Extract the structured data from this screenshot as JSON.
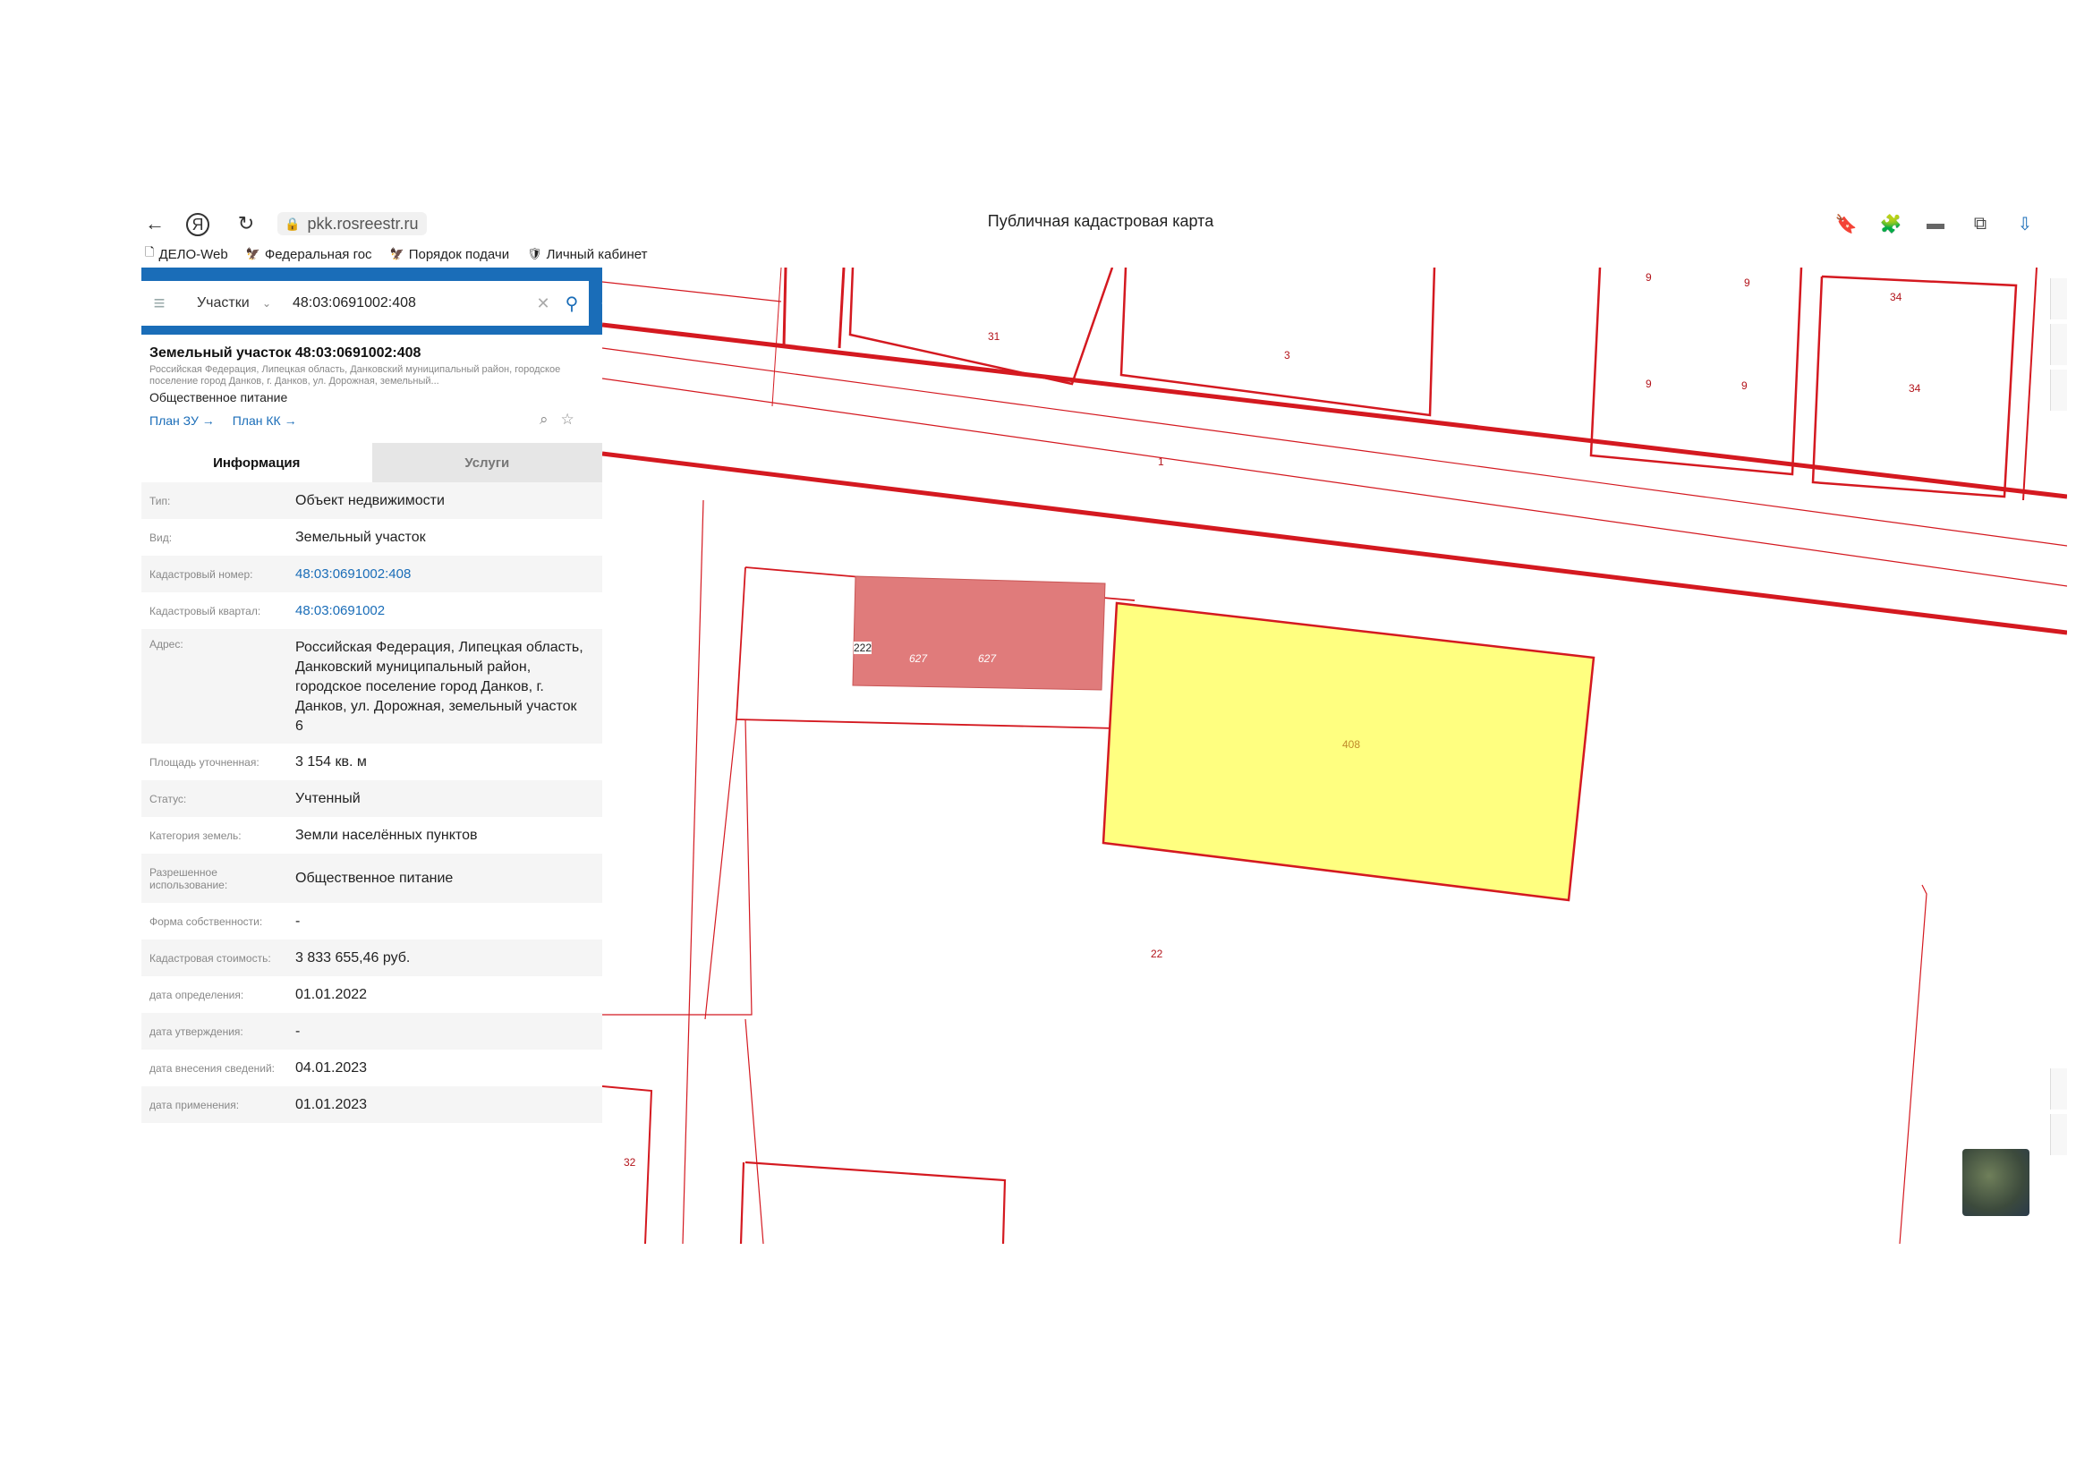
{
  "browser": {
    "url": "pkk.rosreestr.ru",
    "page_title": "Публичная кадастровая карта",
    "bookmarks": [
      {
        "label": "ДЕЛО-Web"
      },
      {
        "label": "Федеральная гос"
      },
      {
        "label": "Порядок подачи"
      },
      {
        "label": "Личный кабинет"
      }
    ]
  },
  "search": {
    "type": "Участки",
    "query": "48:03:0691002:408"
  },
  "object": {
    "title": "Земельный участок 48:03:0691002:408",
    "address_short": "Российская Федерация, Липецкая область, Данковский муниципальный район, городское поселение город Данков, г. Данков, ул. Дорожная, земельный...",
    "use": "Общественное питание",
    "plan_zu": "План ЗУ →",
    "plan_kk": "План КК →"
  },
  "tabs": [
    {
      "label": "Информация"
    },
    {
      "label": "Услуги"
    }
  ],
  "info": [
    {
      "label": "Тип:",
      "value": "Объект недвижимости"
    },
    {
      "label": "Вид:",
      "value": "Земельный участок"
    },
    {
      "label": "Кадастровый номер:",
      "value": "48:03:0691002:408"
    },
    {
      "label": "Кадастровый квартал:",
      "value": "48:03:0691002"
    },
    {
      "label": "Адрес:",
      "value": "Российская Федерация, Липецкая область, Данковский муниципальный район, городское поселение город Данков, г. Данков, ул. Дорожная, земельный участок 6"
    },
    {
      "label": "Площадь уточненная:",
      "value": "3 154 кв. м"
    },
    {
      "label": "Статус:",
      "value": "Учтенный"
    },
    {
      "label": "Категория земель:",
      "value": "Земли населённых пунктов"
    },
    {
      "label": "Разрешенное использование:",
      "value": "Общественное питание"
    },
    {
      "label": "Форма собственности:",
      "value": "-"
    },
    {
      "label": "Кадастровая стоимость:",
      "value": "3 833 655,46 руб."
    },
    {
      "label": "дата определения:",
      "value": "01.01.2022"
    },
    {
      "label": "дата утверждения:",
      "value": "-"
    },
    {
      "label": "дата внесения сведений:",
      "value": "04.01.2023"
    },
    {
      "label": "дата применения:",
      "value": "01.01.2023"
    }
  ],
  "map": {
    "parcel_labels": [
      "31",
      "3",
      "9",
      "9",
      "9",
      "9",
      "34",
      "34",
      "1",
      "222",
      "627",
      "627",
      "408",
      "22",
      "32"
    ],
    "colors": {
      "boundary": "#d41920",
      "selected_fill": "#ffff80",
      "neighbor_fill": "#e07b7b",
      "accent": "#1a6db8"
    }
  }
}
